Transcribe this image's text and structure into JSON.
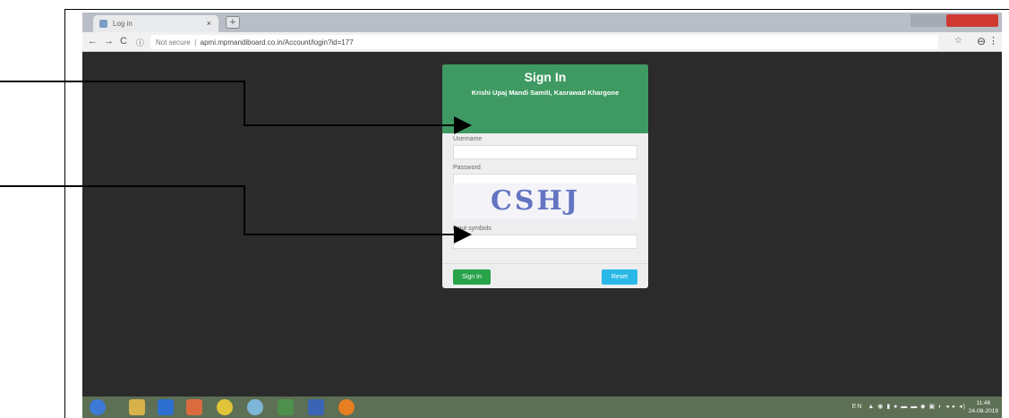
{
  "browser": {
    "tab_title": "Log in",
    "tab_close": "×",
    "new_tab": "+",
    "back": "←",
    "forward": "→",
    "reload": "C",
    "security": "Not secure",
    "url": "apmi.mpmandiboard.co.in/Account/login?id=177",
    "star_icon": "☆",
    "account_icon": "⊖",
    "menu_icon": "⋮"
  },
  "login": {
    "title": "Sign In",
    "subtitle": "Krishi Upaj Mandi Samiti, Kasrawad Khargone",
    "username_label": "Username",
    "password_label": "Password",
    "captcha_text": "CSHJ",
    "captcha_input_label": "input symbols",
    "signin_button": "Sign In",
    "reset_button": "Reset"
  },
  "taskbar": {
    "tray_text": "EN",
    "time": "11:46",
    "date": "24-08-2019"
  },
  "colors": {
    "card_header": "#3e9a62",
    "signin": "#28a34a",
    "reset": "#2ab9e6",
    "page_bg": "#2b2b2b"
  }
}
